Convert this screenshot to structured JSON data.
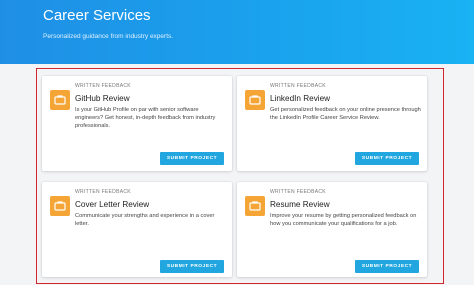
{
  "header": {
    "title": "Career Services",
    "subtitle": "Personalized guidance from industry experts."
  },
  "cards": [
    {
      "tag": "WRITTEN FEEDBACK",
      "title": "GitHub Review",
      "description": "Is your GitHub Profile on par with senior software engineers? Get honest, in-depth feedback from industry professionals.",
      "button": "SUBMIT PROJECT",
      "icon": "briefcase-icon"
    },
    {
      "tag": "WRITTEN FEEDBACK",
      "title": "LinkedIn Review",
      "description": "Get personalized feedback on your online presence through the LinkedIn Profile Career Service Review.",
      "button": "SUBMIT PROJECT",
      "icon": "briefcase-icon"
    },
    {
      "tag": "WRITTEN FEEDBACK",
      "title": "Cover Letter Review",
      "description": "Communicate your strengths and experience in a cover letter.",
      "button": "SUBMIT PROJECT",
      "icon": "briefcase-icon"
    },
    {
      "tag": "WRITTEN FEEDBACK",
      "title": "Resume Review",
      "description": "Improve your resume by getting personalized feedback on how you communicate your qualifications for a job.",
      "button": "SUBMIT PROJECT",
      "icon": "briefcase-icon"
    }
  ],
  "colors": {
    "header_gradient_start": "#1f8fe5",
    "header_gradient_end": "#19b2f3",
    "icon_bg": "#f5a536",
    "button_bg": "#21a6e0",
    "highlight_border": "#d4242c"
  }
}
